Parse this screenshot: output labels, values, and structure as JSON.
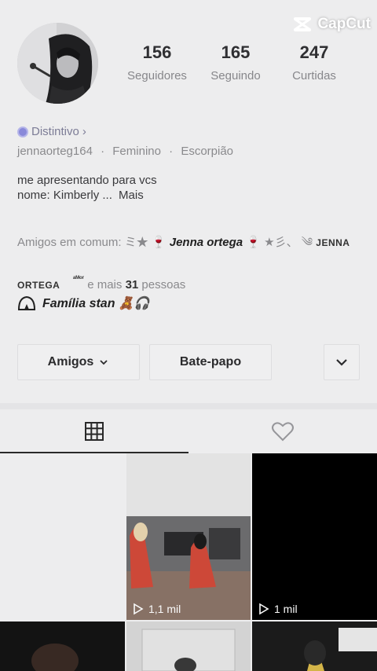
{
  "watermark": {
    "text": "CapCut"
  },
  "profile": {
    "stats": [
      {
        "value": "156",
        "label": "Seguidores"
      },
      {
        "value": "165",
        "label": "Seguindo"
      },
      {
        "value": "247",
        "label": "Curtidas"
      }
    ],
    "badge": "Distintivo",
    "badge_chevron": "›",
    "username": "jennaorteg164",
    "gender": "Feminino",
    "sign": "Escorpião",
    "meta_sep": "·",
    "bio_line1": "me apresentando para vcs",
    "bio_line2": "nome: Kimberly ...",
    "bio_more": "Mais",
    "mutual_prefix": "Amigos em comum:",
    "mutual_deco1": "ミ★ 🍷",
    "mutual_name": "Jenna ortega",
    "mutual_deco2": "🍷 ★彡、 ༄",
    "mutual_small1": "JENNA",
    "mutual_small2": "ORTEGA",
    "mutual_tiny": "ᵃᴹᵒʳ",
    "mutual_more_prefix": "e mais",
    "mutual_count": "31",
    "mutual_suffix": "pessoas",
    "family": "Família stan 🧸🎧"
  },
  "actions": {
    "friends_label": "Amigos",
    "friends_chevron": "⌄",
    "chat_label": "Bate-papo"
  },
  "tabs": {
    "active": "videos-grid"
  },
  "videos": [
    {
      "views": ""
    },
    {
      "views": "1,1 mil"
    },
    {
      "views": "1 mil"
    }
  ]
}
